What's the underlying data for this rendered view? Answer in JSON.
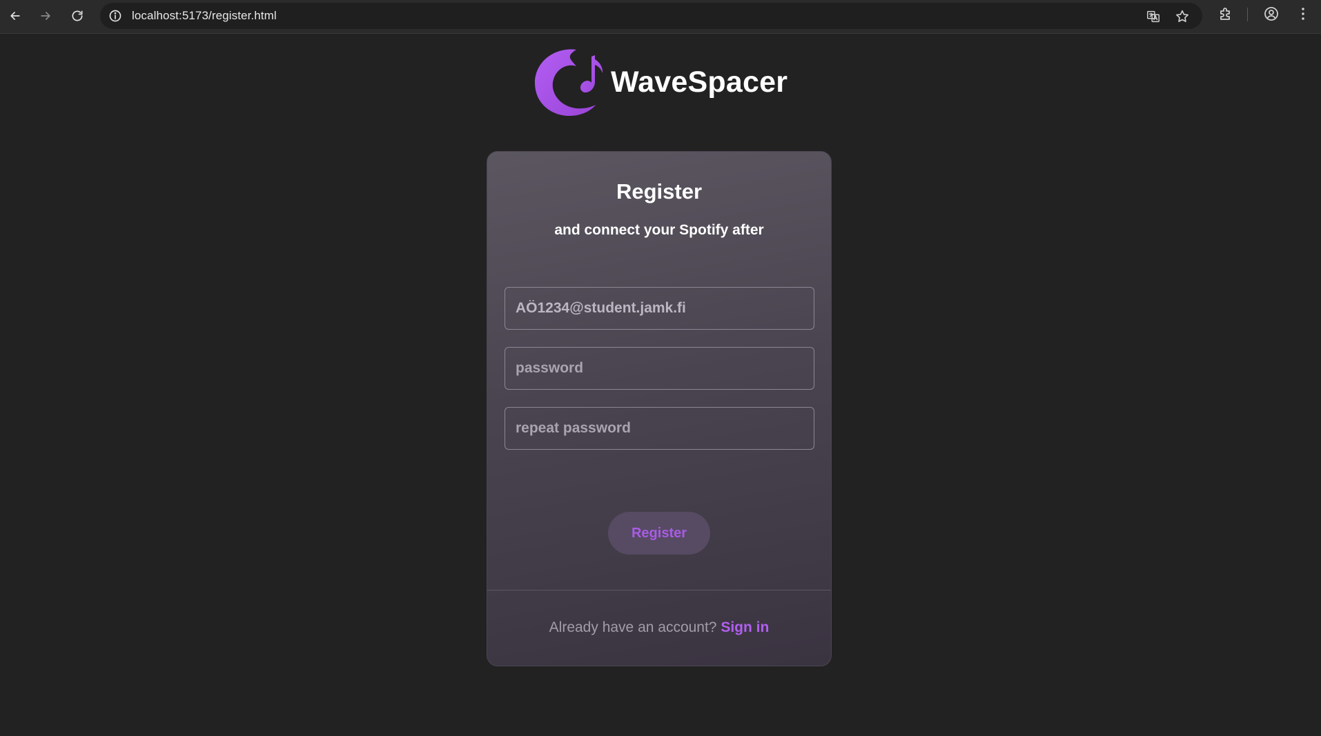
{
  "browser": {
    "url": "localhost:5173/register.html",
    "icons": [
      "back-arrow-icon",
      "forward-arrow-icon",
      "reload-icon",
      "site-info-icon",
      "translate-icon",
      "bookmark-star-icon",
      "extensions-icon",
      "profile-icon",
      "menu-dots-icon"
    ]
  },
  "logo": {
    "text": "WaveSpacer",
    "icon": "wave-music-note-logo",
    "color": "#a44fe0"
  },
  "form": {
    "title": "Register",
    "subtitle": "and connect your Spotify after",
    "email_value": "AÖ1234@student.jamk.fi",
    "password_placeholder": "password",
    "repeat_password_placeholder": "repeat password",
    "submit_label": "Register"
  },
  "footer": {
    "prompt": "Already have an account?",
    "link_label": "Sign in"
  },
  "colors": {
    "background": "#222222",
    "accent": "#b15ff0",
    "card": "#4a4450"
  }
}
